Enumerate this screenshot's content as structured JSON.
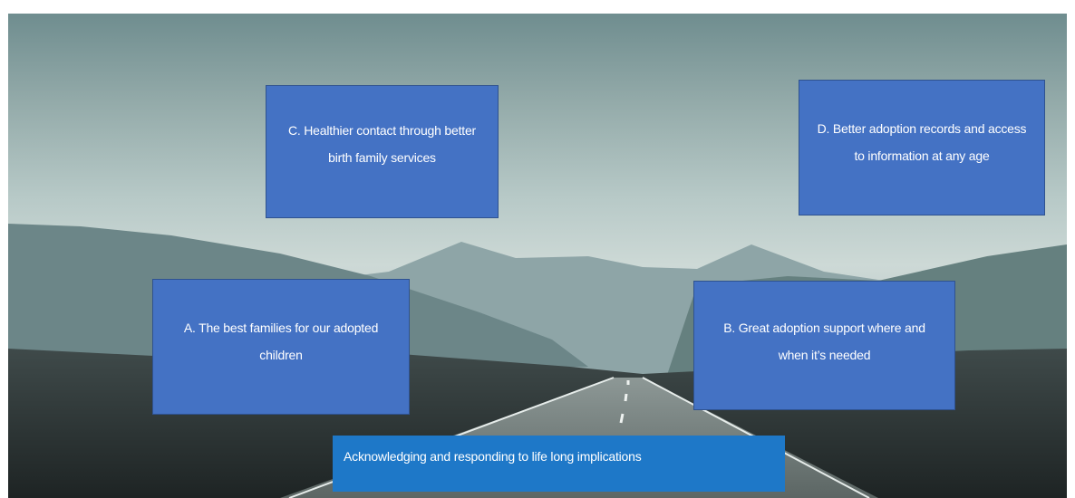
{
  "boxes": {
    "c": "C. Healthier contact through better birth family services",
    "d": "D. Better adoption records and access to information at any age",
    "a": "A. The best families for our adopted children",
    "b": "B. Great adoption support where and when it’s needed"
  },
  "banner": "Acknowledging and responding to  life long implications",
  "colors": {
    "box_fill": "#4472c4",
    "box_border": "#2f528f",
    "banner_fill": "#1e78c8",
    "text": "#ffffff"
  }
}
